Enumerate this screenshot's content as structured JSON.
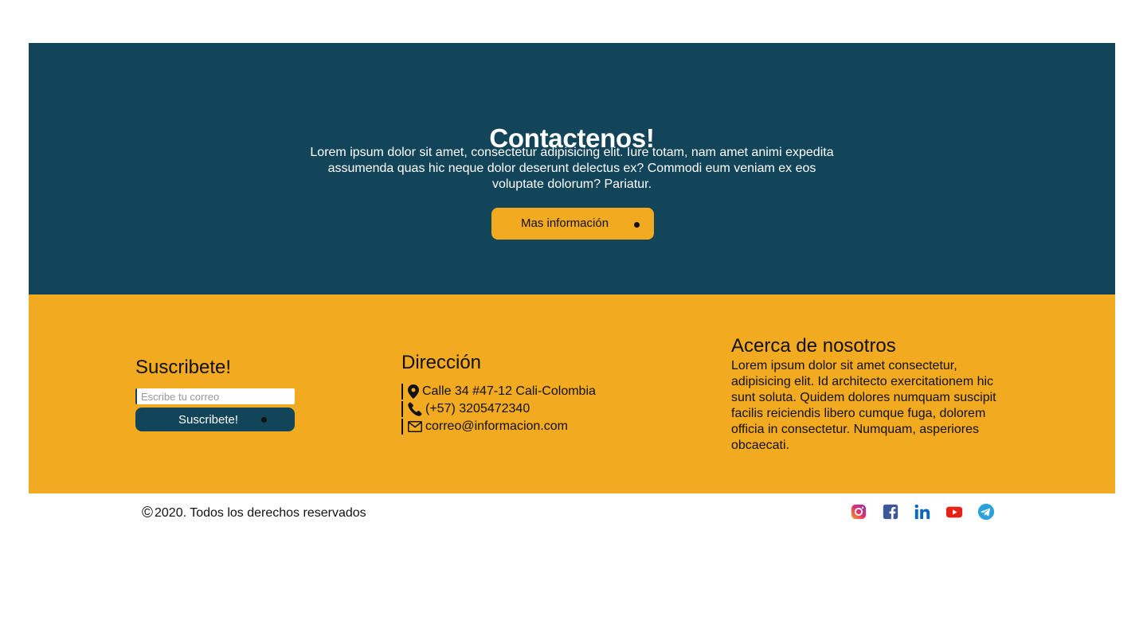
{
  "contact": {
    "title": "Contactenos!",
    "description": "Lorem ipsum dolor sit amet, consectetur adipisicing elit. Iure totam, nam amet animi expedita assumenda quas hic neque dolor deserunt delectus ex? Commodi eum veniam ex eos voluptate dolorum? Pariatur.",
    "button_label": "Mas información"
  },
  "subscribe": {
    "title": "Suscribete!",
    "placeholder": "Escribe tu correo",
    "button_label": "Suscribete!"
  },
  "address": {
    "title": "Dirección",
    "items": [
      {
        "icon": "map-marker-icon",
        "text": "Calle 34 #47-12 Cali-Colombia"
      },
      {
        "icon": "phone-icon",
        "text": "(+57) 3205472340"
      },
      {
        "icon": "envelope-icon",
        "text": "correo@informacion.com"
      }
    ]
  },
  "about": {
    "title": "Acerca de nosotros",
    "text": "Lorem ipsum dolor sit amet consectetur, adipisicing elit. Id architecto exercitationem hic sunt soluta. Quidem dolores numquam suscipit facilis reiciendis libero cumque fuga, dolorem officia in consectetur. Numquam, asperiores obcaecati."
  },
  "footer": {
    "copyright_symbol": "©",
    "copyright_text": "2020. Todos los derechos reservados",
    "social_icons": [
      "instagram-icon",
      "facebook-icon",
      "linkedin-icon",
      "youtube-icon",
      "telegram-icon"
    ]
  },
  "colors": {
    "primary": "#12445a",
    "accent": "#f2aa20"
  }
}
